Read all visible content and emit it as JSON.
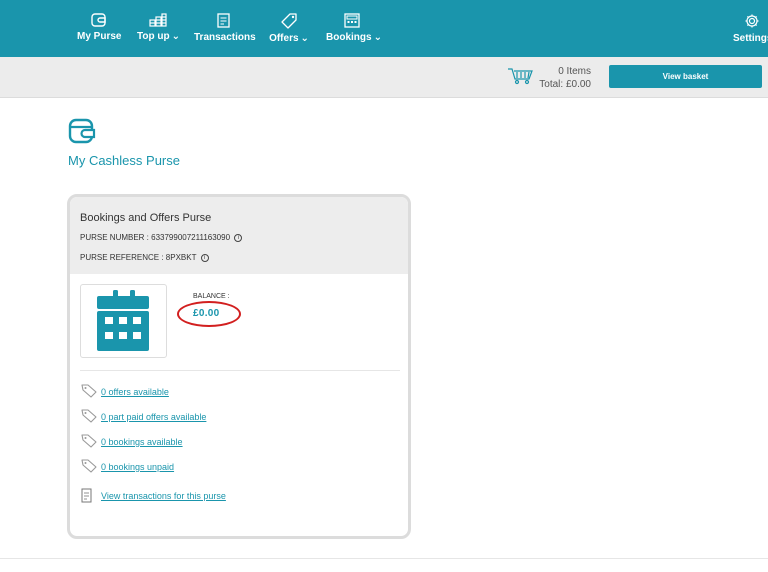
{
  "nav": {
    "items": [
      {
        "label": "My Purse",
        "icon": "wallet-icon"
      },
      {
        "label": "Top up",
        "icon": "coin-stack-icon",
        "caret": "⌄"
      },
      {
        "label": "Transactions",
        "icon": "receipt-icon"
      },
      {
        "label": "Offers",
        "icon": "tag-icon",
        "caret": "⌄"
      },
      {
        "label": "Bookings",
        "icon": "calendar-icon",
        "caret": "⌄"
      },
      {
        "label": "Settings",
        "icon": "gear-icon"
      }
    ]
  },
  "basket": {
    "items_text": "0 Items",
    "total_text": "Total: £0.00",
    "button_label": "View basket"
  },
  "page": {
    "title": "My Cashless Purse"
  },
  "card": {
    "title": "Bookings and Offers Purse",
    "purse_number": "PURSE NUMBER : 633799007211163090",
    "purse_reference": "PURSE REFERENCE : 8PXBKT",
    "info_glyph": "i",
    "balance_label": "BALANCE :",
    "balance_value": "£0.00",
    "links": [
      "0 offers available",
      "0 part paid offers available",
      "0 bookings available",
      "0 bookings unpaid",
      "View transactions for this purse"
    ]
  },
  "colors": {
    "brand": "#1a95ac",
    "annotation_ring": "#d21f1f"
  }
}
